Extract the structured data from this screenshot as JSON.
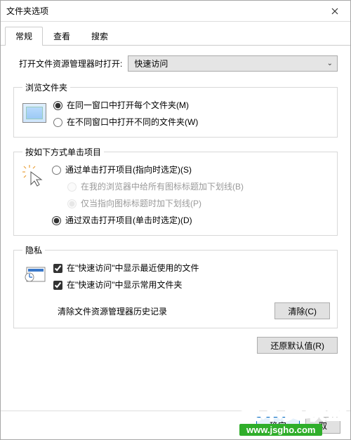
{
  "window": {
    "title": "文件夹选项"
  },
  "tabs": {
    "general": "常规",
    "view": "查看",
    "search": "搜索"
  },
  "top": {
    "label": "打开文件资源管理器时打开:",
    "select_value": "快速访问"
  },
  "browse": {
    "legend": "浏览文件夹",
    "same_window": "在同一窗口中打开每个文件夹(M)",
    "new_window": "在不同窗口中打开不同的文件夹(W)"
  },
  "click": {
    "legend": "按如下方式单击项目",
    "single_click": "通过单击打开项目(指向时选定)(S)",
    "underline_all": "在我的浏览器中给所有图标标题加下划线(B)",
    "underline_point": "仅当指向图标标题时加下划线(P)",
    "double_click": "通过双击打开项目(单击时选定)(D)"
  },
  "privacy": {
    "legend": "隐私",
    "recent_files": "在\"快速访问\"中显示最近使用的文件",
    "frequent_folders": "在\"快速访问\"中显示常用文件夹",
    "clear_label": "清除文件资源管理器历史记录",
    "clear_btn": "清除(C)"
  },
  "restore_btn": "还原默认值(R)",
  "footer": {
    "ok": "确定",
    "cancel": "取"
  },
  "watermark": {
    "text": "技术员联盟",
    "url": "www.jsgho.com"
  }
}
